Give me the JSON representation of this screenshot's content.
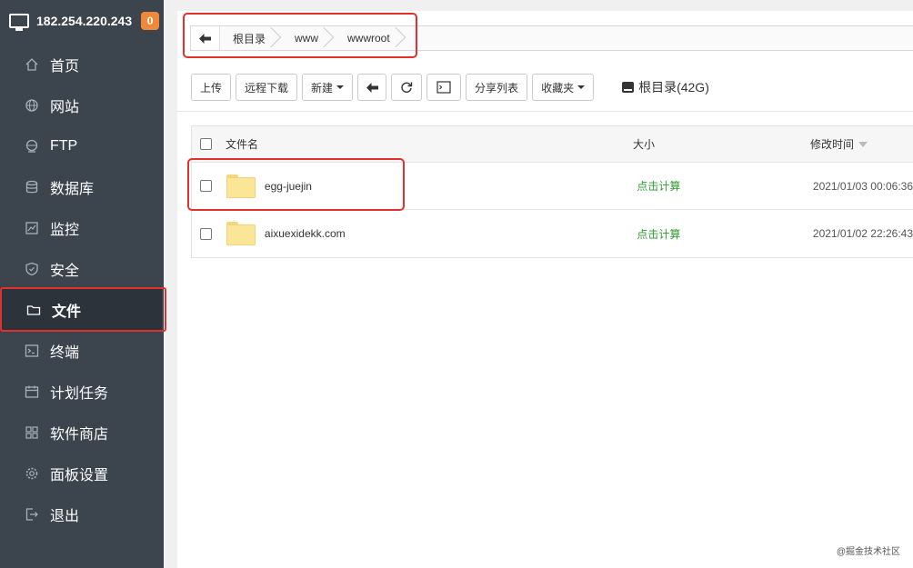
{
  "sidebar": {
    "ip": "182.254.220.243",
    "badge": "0",
    "items": [
      {
        "label": "首页",
        "icon": "home-icon"
      },
      {
        "label": "网站",
        "icon": "globe-icon"
      },
      {
        "label": "FTP",
        "icon": "ftp-icon"
      },
      {
        "label": "数据库",
        "icon": "database-icon"
      },
      {
        "label": "监控",
        "icon": "monitor-chart-icon"
      },
      {
        "label": "安全",
        "icon": "shield-icon"
      },
      {
        "label": "文件",
        "icon": "folder-icon"
      },
      {
        "label": "终端",
        "icon": "terminal-icon"
      },
      {
        "label": "计划任务",
        "icon": "calendar-icon"
      },
      {
        "label": "软件商店",
        "icon": "grid-icon"
      },
      {
        "label": "面板设置",
        "icon": "gear-icon"
      },
      {
        "label": "退出",
        "icon": "logout-icon"
      }
    ],
    "active_index": 6
  },
  "breadcrumb": {
    "items": [
      "根目录",
      "www",
      "wwwroot"
    ]
  },
  "toolbar": {
    "upload": "上传",
    "remote_download": "远程下载",
    "new": "新建",
    "share_list": "分享列表",
    "favorites": "收藏夹",
    "disk": "根目录(42G)"
  },
  "table": {
    "headers": {
      "name": "文件名",
      "size": "大小",
      "modified": "修改时间"
    },
    "rows": [
      {
        "name": "egg-juejin",
        "size": "点击计算",
        "modified": "2021/01/03 00:06:36"
      },
      {
        "name": "aixuexidekk.com",
        "size": "点击计算",
        "modified": "2021/01/02 22:26:43"
      }
    ]
  },
  "watermark": "@掘金技术社区",
  "colors": {
    "sidebar_bg": "#3c444d",
    "highlight": "#e0312f",
    "badge": "#f0883a",
    "size_text": "#2e9a2e"
  }
}
